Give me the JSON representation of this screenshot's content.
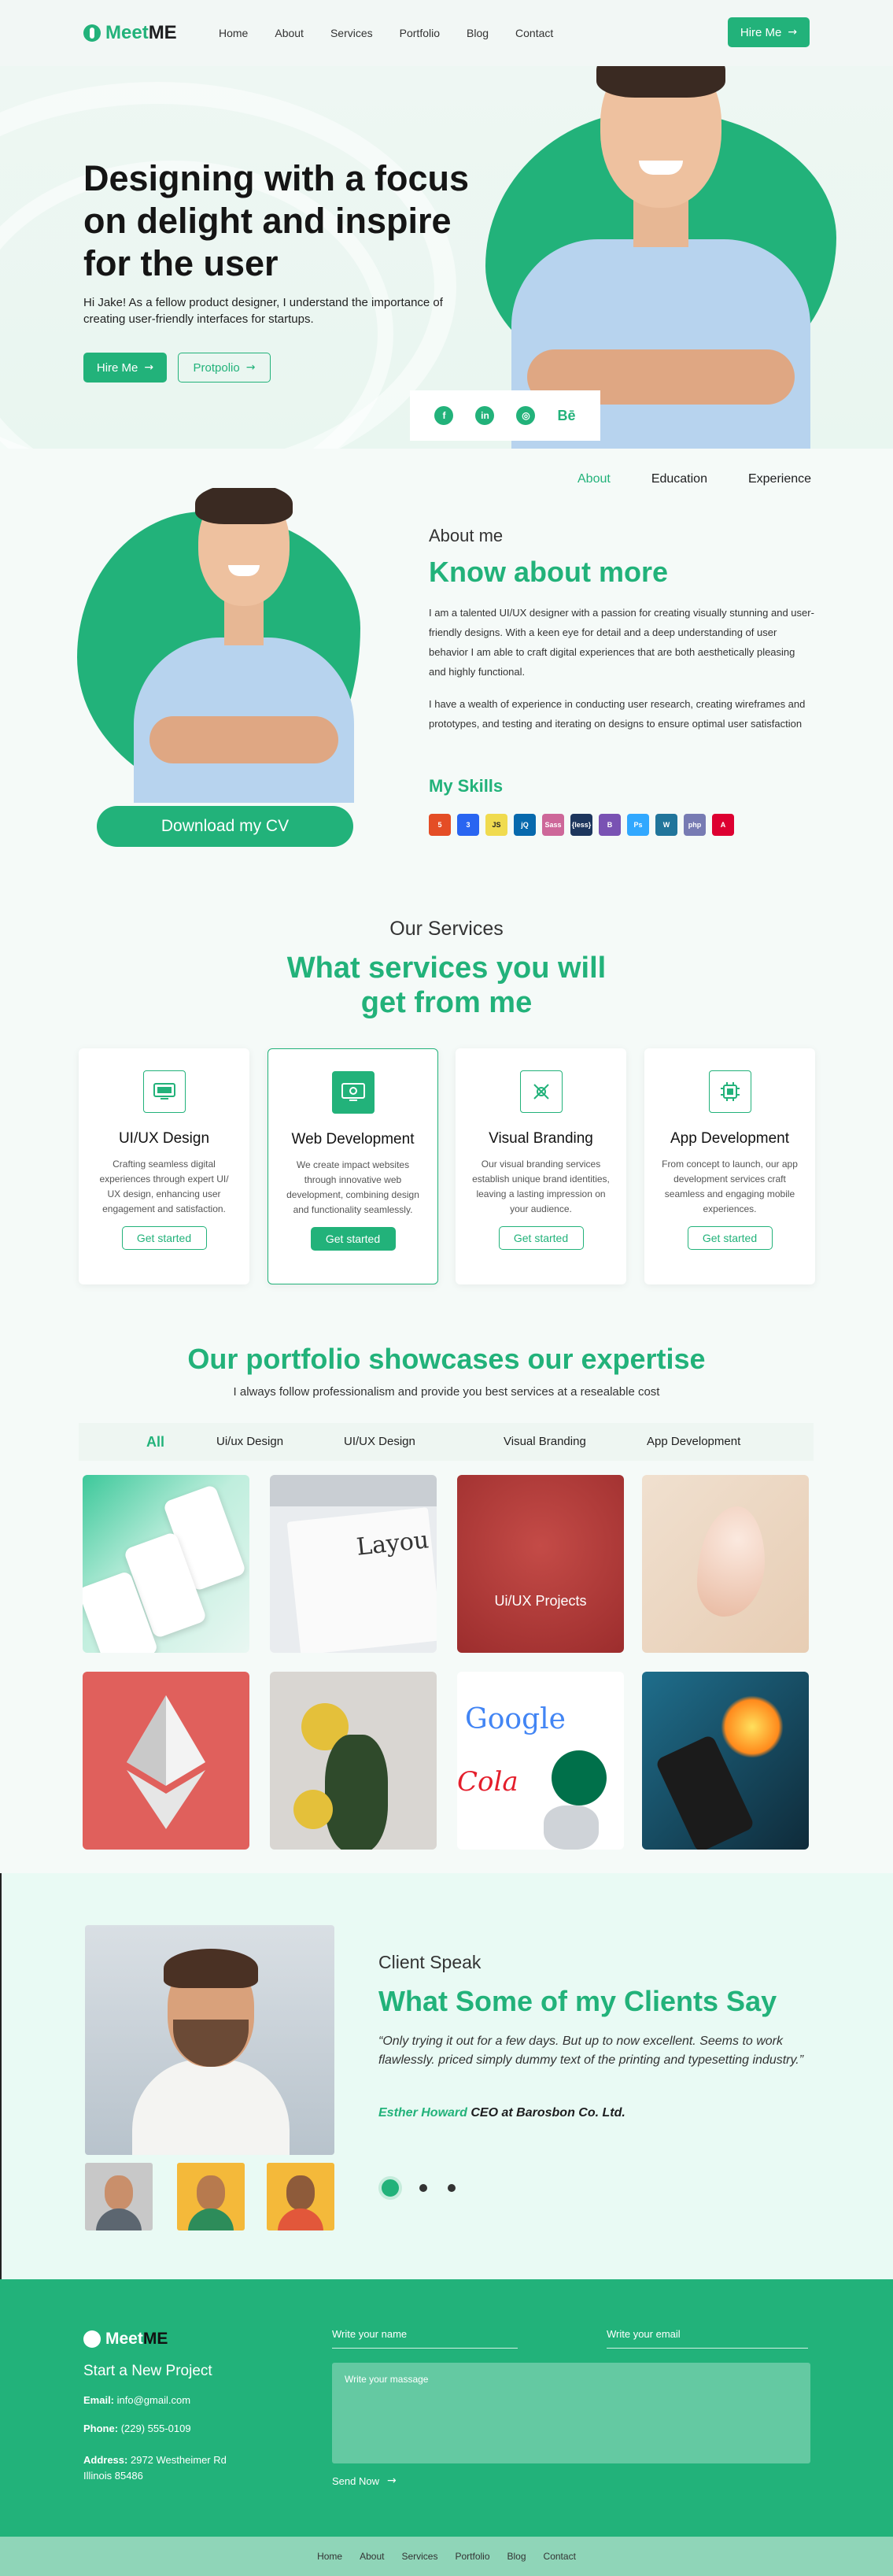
{
  "brand": {
    "name_part1": "Meet",
    "name_part2": "ME"
  },
  "nav": [
    "Home",
    "About",
    "Services",
    "Portfolio",
    "Blog",
    "Contact"
  ],
  "header": {
    "hire_label": "Hire Me"
  },
  "hero": {
    "title": "Designing with a focus on delight and inspire for the user",
    "subtitle": "Hi Jake! As a fellow product designer, I understand the importance of creating user-friendly interfaces for startups.",
    "hire_label": "Hire Me",
    "portfolio_label": "Protpolio",
    "socials": [
      "f",
      "in",
      "◎",
      "Bē"
    ]
  },
  "about": {
    "tabs": [
      "About",
      "Education",
      "Experience"
    ],
    "eyebrow": "About me",
    "heading": "Know about more",
    "paragraph1": "I am a talented UI/UX designer with a passion for creating visually stunning and user-friendly designs. With a keen eye for detail and a deep understanding of user behavior I am able to craft digital experiences that are both aesthetically pleasing and highly functional.",
    "paragraph2": "I have a wealth of experience in conducting user research, creating wireframes and prototypes, and testing and iterating on designs to ensure optimal user satisfaction",
    "cv_label": "Download my CV",
    "skills_title": "My Skills",
    "skills": [
      {
        "label": "5",
        "color": "#e44d26"
      },
      {
        "label": "3",
        "color": "#2965f1"
      },
      {
        "label": "JS",
        "color": "#f0db4f"
      },
      {
        "label": "jQ",
        "color": "#0769ad"
      },
      {
        "label": "Sass",
        "color": "#cd6799"
      },
      {
        "label": "{less}",
        "color": "#1d365d"
      },
      {
        "label": "B",
        "color": "#7952b3"
      },
      {
        "label": "Ps",
        "color": "#31a8ff"
      },
      {
        "label": "W",
        "color": "#21759b"
      },
      {
        "label": "php",
        "color": "#777bb3"
      },
      {
        "label": "A",
        "color": "#dd0031"
      }
    ]
  },
  "services": {
    "eyebrow": "Our Services",
    "heading_line1": "What services you will",
    "heading_line2": "get from me",
    "cards": [
      {
        "title": "UI/UX Design",
        "text": "Crafting seamless digital experiences through expert UI/ UX design, enhancing user engagement and satisfaction.",
        "button": "Get started"
      },
      {
        "title": "Web Development",
        "text": "We create impact websites through innovative web development, combining design and functionality seamlessly.",
        "button": "Get started"
      },
      {
        "title": "Visual  Branding",
        "text": "Our visual branding services establish unique brand identities, leaving a lasting impression on your audience.",
        "button": "Get started"
      },
      {
        "title": "App Development",
        "text": "From concept to launch, our app development services craft seamless and engaging mobile experiences.",
        "button": "Get started"
      }
    ]
  },
  "portfolio": {
    "heading": "Our portfolio showcases our expertise",
    "subtitle": "I always follow professionalism and provide you  best services at a resealable cost",
    "tabs": [
      "All",
      "Ui/ux Design",
      "UI/UX  Design",
      "Visual Branding",
      "App  Development"
    ],
    "overlay_label": "Ui/UX Projects"
  },
  "clients": {
    "eyebrow": "Client Speak",
    "heading": "What Some of my Clients Say",
    "quote": "“Only trying it out for a few days. But up to now excellent. Seems to work flawlessly. priced simply dummy text of the printing and typesetting industry.”",
    "author": "Esther Howard",
    "company": "CEO at Barosbon Co. Ltd."
  },
  "footer": {
    "tagline": "Start a New Project",
    "email_label": "Email:",
    "email": "info@gmail.com",
    "phone_label": "Phone:",
    "phone": "(229) 555-0109",
    "address_label": "Address:",
    "address_line1": "2972 Westheimer Rd",
    "address_line2": "Illinois 85486",
    "name_placeholder": "Write your name",
    "email_placeholder": "Write your email",
    "message_placeholder": "Write your massage",
    "send_label": "Send Now"
  },
  "colors": {
    "accent": "#22b27a",
    "footer_bottom": "#8fd5b8"
  }
}
